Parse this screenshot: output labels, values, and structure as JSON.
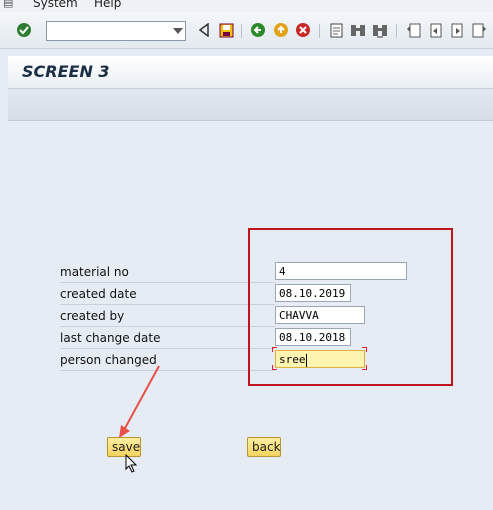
{
  "menubar": {
    "items": [
      {
        "label": "System"
      },
      {
        "label": "Help"
      }
    ],
    "menu_icon": "menu-icon"
  },
  "toolbar": {
    "command_field": {
      "value": "",
      "placeholder": ""
    },
    "icons": [
      "enter-check-icon",
      "back-triangle-icon",
      "save-icon",
      "back-icon",
      "exit-icon",
      "cancel-icon",
      "print-icon",
      "find-icon",
      "find-next-icon",
      "first-page-icon",
      "previous-page-icon",
      "next-page-icon",
      "last-page-icon"
    ]
  },
  "screen": {
    "title": "SCREEN 3"
  },
  "form": {
    "fields": [
      {
        "label": "material no",
        "value": "4"
      },
      {
        "label": "created date",
        "value": "08.10.2019"
      },
      {
        "label": "created by",
        "value": "CHAVVA"
      },
      {
        "label": "last change date",
        "value": "08.10.2018"
      },
      {
        "label": "person changed",
        "value": "sree"
      }
    ]
  },
  "buttons": {
    "save": "save",
    "back": "back"
  },
  "colors": {
    "highlight_box": "#c0141c",
    "arrow": "#e8504a",
    "button_fill": "#f5d360",
    "focused_field": "#fff5b1"
  }
}
